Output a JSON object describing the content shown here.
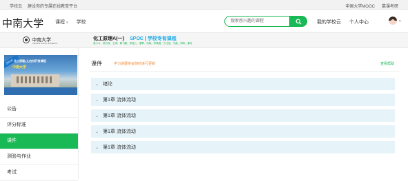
{
  "topbar": {
    "brand": "学校云",
    "slogan": "建设你的专属在线教育平台",
    "right_links": [
      "中国大学MOOC",
      "慕课考研"
    ]
  },
  "header": {
    "logo": "中南大学",
    "nav": [
      {
        "label": "课程",
        "has_caret": true
      },
      {
        "label": "学校",
        "has_caret": false
      }
    ],
    "search_placeholder": "搜索感兴趣的课程",
    "links": [
      "我的学校云",
      "个人中心"
    ],
    "avatar_caret": "▾"
  },
  "coursebar": {
    "school_logo_text": "中南大学",
    "school_logo_en": "CENTRAL SOUTH UNIVERSITY",
    "course_title": "化工原理A(一)",
    "spoc_label": "SPOC | 学校专有课程",
    "teachers": "张小斗、杨方凯、王琪、黄飞鹏、郑益仁、谭草、刘美、李佩国、方江松、马鑫、刘晖、秦玲"
  },
  "sidebar": {
    "banner": {
      "tag": "SPOC",
      "line1": "化工原理(上)在线开放课程",
      "line2": "中南大学"
    },
    "items": [
      {
        "label": "公告",
        "active": false
      },
      {
        "label": "评分标准",
        "active": false
      },
      {
        "label": "课件",
        "active": true
      },
      {
        "label": "测验与作业",
        "active": false
      },
      {
        "label": "考试",
        "active": false
      }
    ]
  },
  "main": {
    "heading": "课件",
    "notice": "学习进展将会随时进行更新",
    "help": "查看帮助",
    "chapters": [
      "绪论",
      "第1章 流体流动",
      "第1章 流体流动",
      "第1章 流体流动",
      "第1章 流体流动"
    ]
  },
  "colors": {
    "accent_green": "#19b955",
    "spoc_blue": "#19a9e6",
    "notice_orange": "#f08c3c",
    "chapter_bg": "#e6f4fa"
  }
}
